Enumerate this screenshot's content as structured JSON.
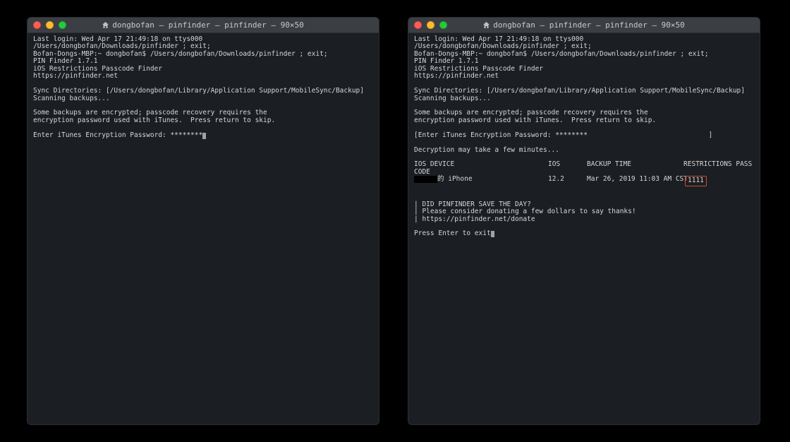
{
  "windows": {
    "left": {
      "title": "dongbofan — pinfinder — pinfinder — 90×50",
      "lastlogin": "Last login: Wed Apr 17 21:49:18 on ttys000",
      "cwd": "/Users/dongbofan/Downloads/pinfinder ; exit;",
      "prompt_line": "Bofan-Dongs-MBP:~ dongbofan$ /Users/dongbofan/Downloads/pinfinder ; exit;",
      "app_line1": "PIN Finder 1.7.1",
      "app_line2": "iOS Restrictions Passcode Finder",
      "app_line3": "https://pinfinder.net",
      "sync_line": "Sync Directories: [/Users/dongbofan/Library/Application Support/MobileSync/Backup]",
      "scan_line": "Scanning backups...",
      "enc_line1": "Some backups are encrypted; passcode recovery requires the",
      "enc_line2": "encryption password used with iTunes.  Press return to skip.",
      "enter_pass": "Enter iTunes Encryption Password: ********"
    },
    "right": {
      "title": "dongbofan — pinfinder — pinfinder — 90×50",
      "lastlogin": "Last login: Wed Apr 17 21:49:18 on ttys000",
      "cwd": "/Users/dongbofan/Downloads/pinfinder ; exit;",
      "prompt_line": "Bofan-Dongs-MBP:~ dongbofan$ /Users/dongbofan/Downloads/pinfinder ; exit;",
      "app_line1": "PIN Finder 1.7.1",
      "app_line2": "iOS Restrictions Passcode Finder",
      "app_line3": "https://pinfinder.net",
      "sync_line": "Sync Directories: [/Users/dongbofan/Library/Application Support/MobileSync/Backup]",
      "scan_line": "Scanning backups...",
      "enc_line1": "Some backups are encrypted; passcode recovery requires the",
      "enc_line2": "encryption password used with iTunes.  Press return to skip.",
      "enter_pass_open": "[",
      "enter_pass": "Enter iTunes Encryption Password: ********",
      "enter_pass_close": "                              ]",
      "decrypt_line": "Decryption may take a few minutes...",
      "table": {
        "h_device": "IOS DEVICE",
        "h_ios": "IOS",
        "h_time": "BACKUP TIME",
        "h_pass": "RESTRICTIONS PASS",
        "h_code": "CODE",
        "row": {
          "device_suffix": "的 iPhone",
          "ios": "12.2",
          "time": "Mar 26, 2019 11:03 AM CST",
          "pass": "1111"
        }
      },
      "donate1": "| DID PINFINDER SAVE THE DAY?",
      "donate2": "| Please consider donating a few dollars to say thanks!",
      "donate3": "| https://pinfinder.net/donate",
      "exit_line": "Press Enter to exit"
    }
  }
}
